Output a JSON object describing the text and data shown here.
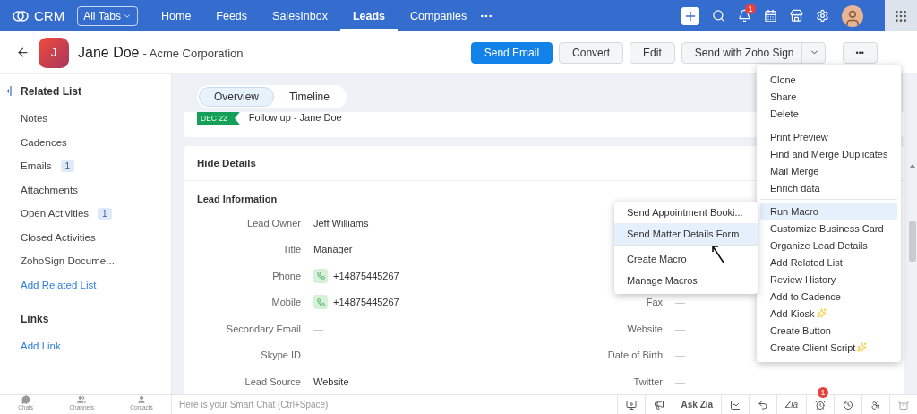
{
  "topbar": {
    "logo": "CRM",
    "all_tabs": "All Tabs",
    "tabs": [
      {
        "label": "Home",
        "selected": false
      },
      {
        "label": "Feeds",
        "selected": false
      },
      {
        "label": "SalesInbox",
        "selected": false
      },
      {
        "label": "Leads",
        "selected": true
      },
      {
        "label": "Companies",
        "selected": false
      }
    ],
    "notification_count": "1"
  },
  "record": {
    "initial": "J",
    "name": "Jane Doe",
    "company": "- Acme Corporation",
    "actions": [
      {
        "label": "Send Email",
        "kind": "primary"
      },
      {
        "label": "Convert",
        "kind": "plain"
      },
      {
        "label": "Edit",
        "kind": "plain"
      },
      {
        "label": "Send with Zoho Sign",
        "kind": "split"
      },
      {
        "label": "•••",
        "kind": "more"
      }
    ]
  },
  "sidebar": {
    "title": "Related List",
    "items": [
      {
        "label": "Notes",
        "kind": "item"
      },
      {
        "label": "Cadences",
        "kind": "item"
      },
      {
        "label": "Emails",
        "kind": "item",
        "count": "1"
      },
      {
        "label": "Attachments",
        "kind": "item"
      },
      {
        "label": "Open Activities",
        "kind": "item",
        "count": "1"
      },
      {
        "label": "Closed Activities",
        "kind": "item"
      },
      {
        "label": "ZohoSign Docume...",
        "kind": "item"
      },
      {
        "label": "Add Related List",
        "kind": "link"
      }
    ],
    "links_title": "Links",
    "links": [
      {
        "label": "Add Link",
        "kind": "link"
      }
    ]
  },
  "view_tabs": [
    {
      "label": "Overview",
      "selected": true
    },
    {
      "label": "Timeline",
      "selected": false
    }
  ],
  "activity": {
    "date": "DEC 22",
    "title": "Follow up - Jane Doe"
  },
  "details": {
    "toggle": "Hide Details",
    "section": "Lead Information",
    "left": [
      {
        "label": "Lead Owner",
        "value": "Jeff Williams",
        "kind": "text"
      },
      {
        "label": "Title",
        "value": "Manager",
        "kind": "text"
      },
      {
        "label": "Phone",
        "value": "+14875445267",
        "kind": "phone"
      },
      {
        "label": "Mobile",
        "value": "+14875445267",
        "kind": "phone"
      },
      {
        "label": "Secondary Email",
        "value": "—",
        "kind": "empty"
      },
      {
        "label": "Skype ID",
        "kind": "text"
      },
      {
        "label": "Lead Source",
        "value": "Website",
        "kind": "text"
      }
    ],
    "right": [
      {
        "label": "Fax",
        "value": "—",
        "kind": "empty"
      },
      {
        "label": "Website",
        "value": "—",
        "kind": "empty"
      },
      {
        "label": "Date of Birth",
        "value": "—",
        "kind": "empty"
      },
      {
        "label": "Twitter",
        "value": "—",
        "kind": "empty"
      }
    ]
  },
  "more_menu": [
    [
      {
        "label": "Clone",
        "selected": false,
        "sparkle": false
      },
      {
        "label": "Share",
        "selected": false,
        "sparkle": false
      },
      {
        "label": "Delete",
        "selected": false,
        "sparkle": false
      }
    ],
    [
      {
        "label": "Print Preview",
        "selected": false,
        "sparkle": false
      },
      {
        "label": "Find and Merge Duplicates",
        "selected": false,
        "sparkle": false
      },
      {
        "label": "Mail Merge",
        "selected": false,
        "sparkle": false
      },
      {
        "label": "Enrich data",
        "selected": false,
        "sparkle": false
      }
    ],
    [
      {
        "label": "Run Macro",
        "selected": true,
        "sparkle": false
      },
      {
        "label": "Customize Business Card",
        "selected": false,
        "sparkle": false
      },
      {
        "label": "Organize Lead Details",
        "selected": false,
        "sparkle": false
      },
      {
        "label": "Add Related List",
        "selected": false,
        "sparkle": false
      },
      {
        "label": "Review History",
        "selected": false,
        "sparkle": false
      },
      {
        "label": "Add to Cadence",
        "selected": false,
        "sparkle": false
      },
      {
        "label": "Add Kiosk",
        "selected": false,
        "sparkle": true
      },
      {
        "label": "Create Button",
        "selected": false,
        "sparkle": false
      },
      {
        "label": "Create Client Script",
        "selected": false,
        "sparkle": true
      }
    ]
  ],
  "macro_menu": [
    [
      {
        "label": "Send Appointment Booki...",
        "selected": false
      },
      {
        "label": "Send Matter Details Form",
        "selected": true
      }
    ],
    [
      {
        "label": "Create Macro",
        "selected": false
      },
      {
        "label": "Manage Macros",
        "selected": false
      }
    ]
  ],
  "bottombar": {
    "dock": [
      "Chats",
      "Channels",
      "Contacts"
    ],
    "chat_placeholder": "Here is your Smart Chat (Ctrl+Space)",
    "ask_zia": "Ask Zia",
    "zia_logo": "Zia",
    "alarm_count": "1"
  }
}
